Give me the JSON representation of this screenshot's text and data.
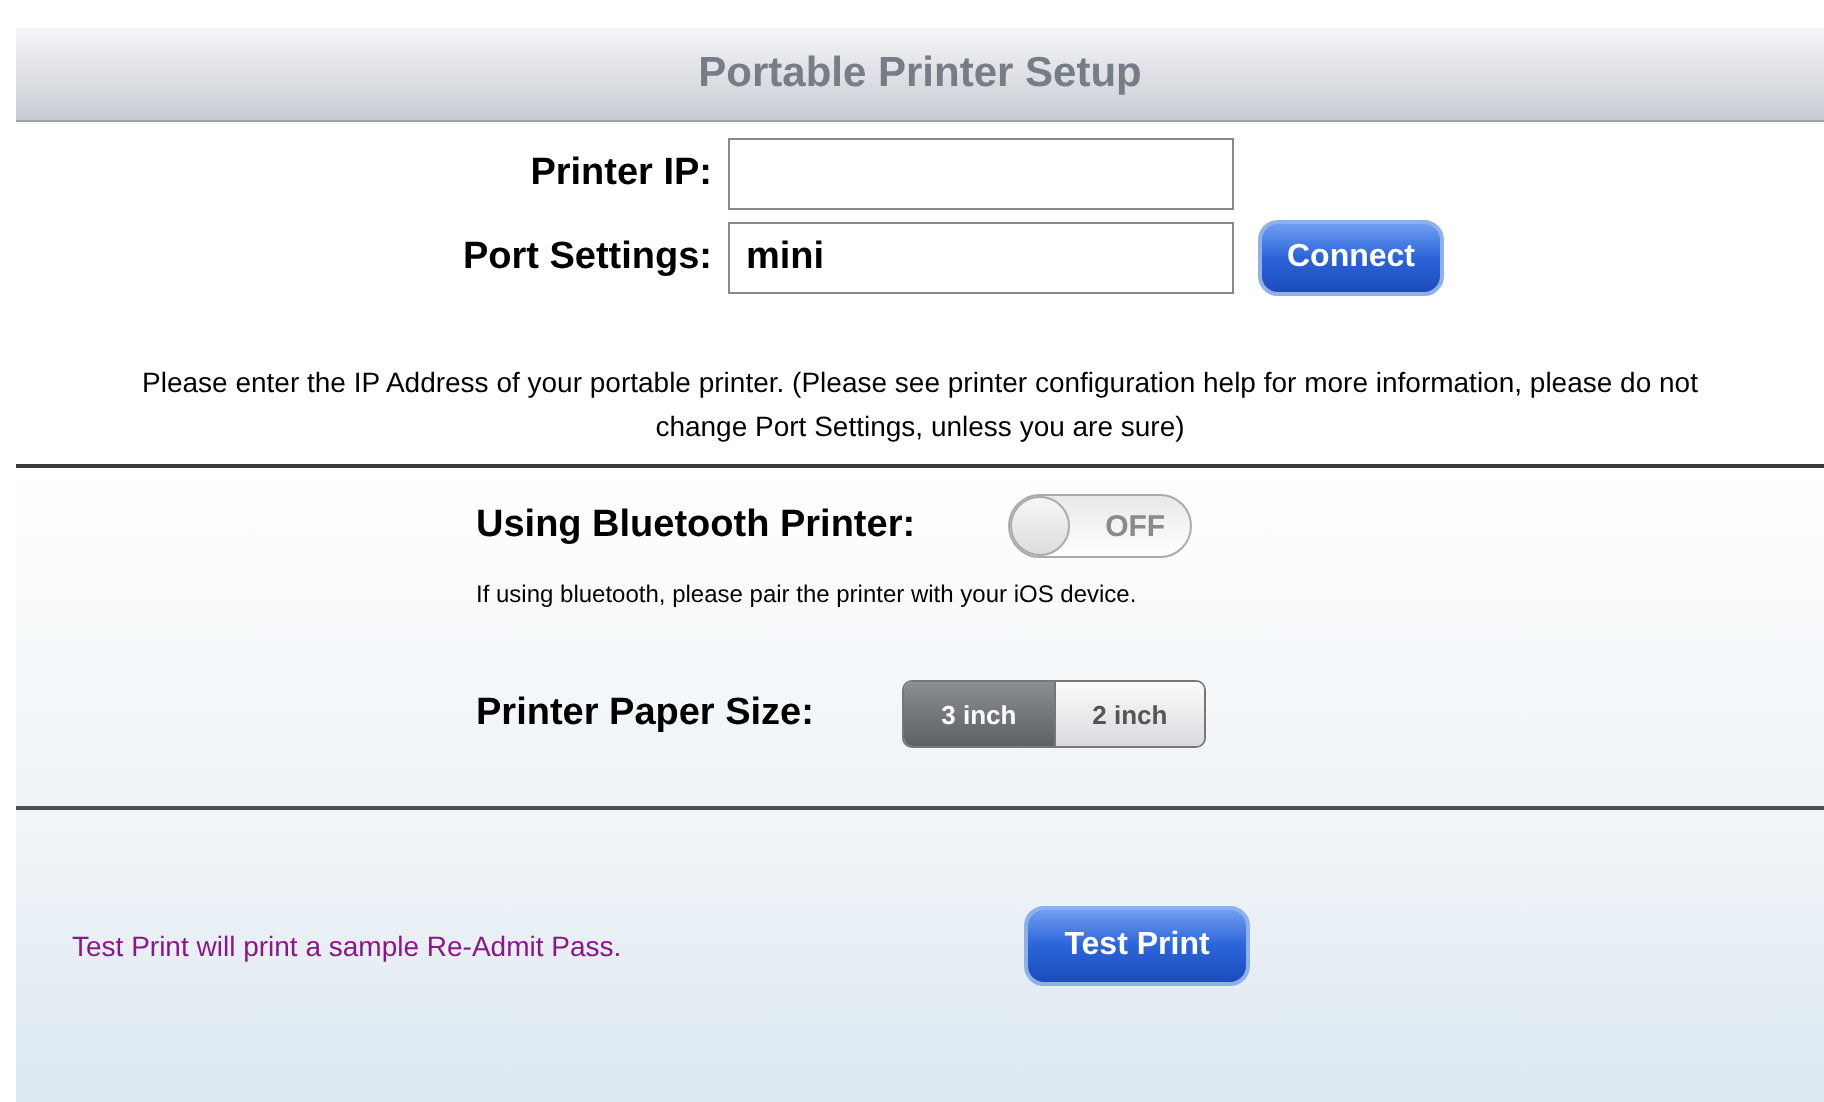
{
  "header": {
    "title": "Portable Printer Setup"
  },
  "form": {
    "fields": [
      {
        "label": "Printer IP:"
      },
      {
        "label": "Port Settings:",
        "value": "mini"
      }
    ],
    "connect_button": "Connect",
    "help_text": "Please enter the IP Address of your portable printer.  (Please see printer configuration help for more information, please do not change Port Settings, unless you are sure)"
  },
  "bluetooth": {
    "label": "Using Bluetooth Printer:",
    "toggle": {
      "on": false,
      "text": "OFF"
    },
    "hint": "If using bluetooth, please pair the printer with your iOS device."
  },
  "paper_size": {
    "label": "Printer Paper Size:",
    "options": [
      {
        "label": "3 inch",
        "selected": true
      },
      {
        "label": "2 inch",
        "selected": false
      }
    ]
  },
  "test": {
    "text": "Test Print will print a sample Re-Admit Pass.",
    "button": "Test Print"
  }
}
